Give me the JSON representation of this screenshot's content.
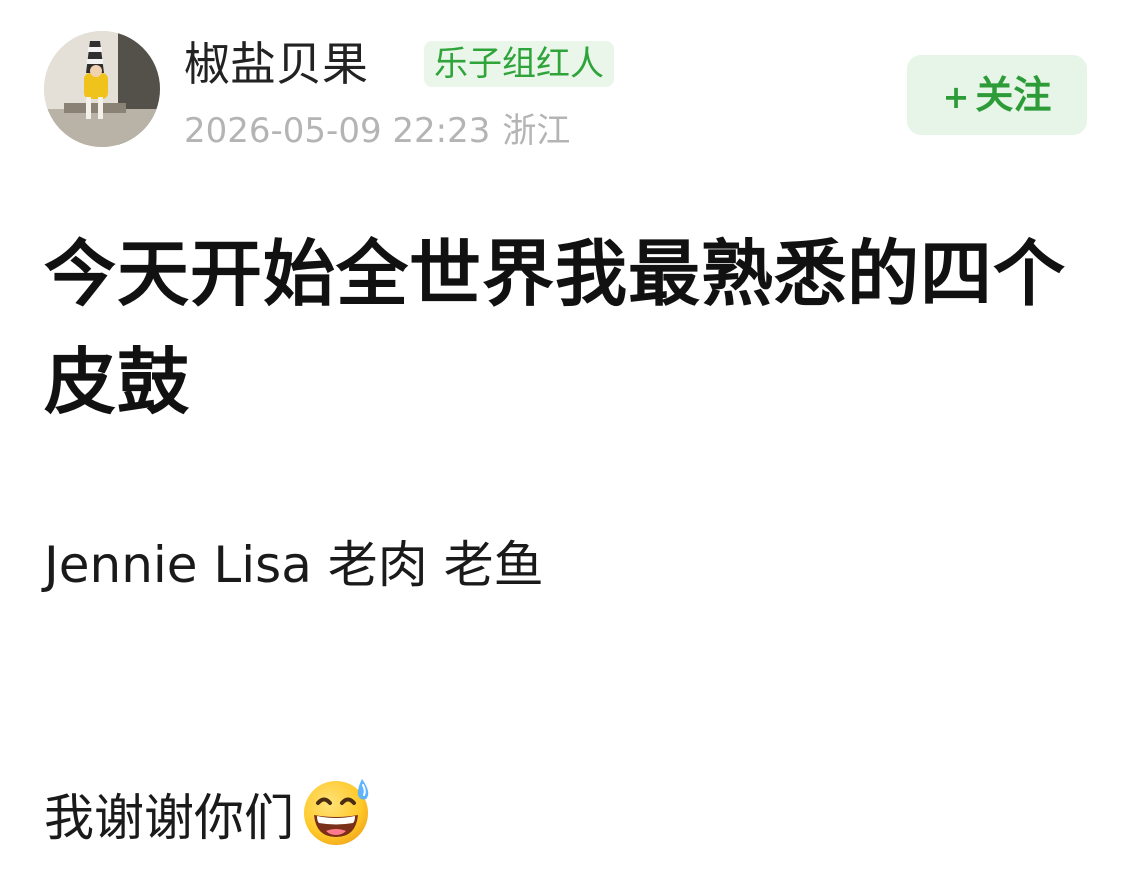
{
  "author": {
    "name": "椒盐贝果",
    "badge": "乐子组红人",
    "date": "2026-05-09 22:23",
    "location": "浙江",
    "avatar_icon": "avatar-photo"
  },
  "follow": {
    "plus": "+",
    "label": "关注"
  },
  "post": {
    "title": "今天开始全世界我最熟悉的四个皮鼓",
    "line1": "Jennie Lisa 老肉 老鱼",
    "line2": "我谢谢你们",
    "emoji_icon": "grinning-sweat-emoji"
  },
  "colors": {
    "accent_green": "#2d9b37",
    "badge_bg": "#e9f6e9",
    "meta_gray": "#b4b4b4"
  }
}
